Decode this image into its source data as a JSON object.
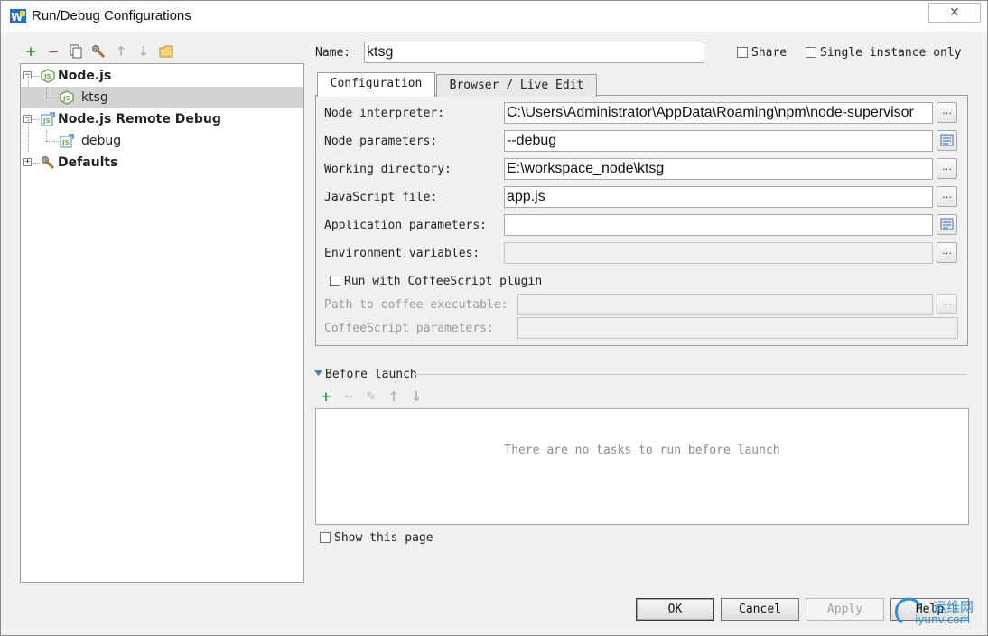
{
  "window": {
    "title": "Run/Debug Configurations"
  },
  "tree": {
    "items": [
      {
        "label": "Node.js"
      },
      {
        "label": "ktsg"
      },
      {
        "label": "Node.js Remote Debug"
      },
      {
        "label": "debug"
      },
      {
        "label": "Defaults"
      }
    ]
  },
  "name_row": {
    "label": "Name:",
    "value": "ktsg",
    "share_label": "Share",
    "single_instance_label": "Single instance only"
  },
  "tabs": [
    {
      "label": "Configuration"
    },
    {
      "label": "Browser / Live Edit"
    }
  ],
  "config": {
    "node_interpreter": {
      "label": "Node interpreter:",
      "value": "C:\\Users\\Administrator\\AppData\\Roaming\\npm\\node-supervisor"
    },
    "node_parameters": {
      "label": "Node parameters:",
      "value": "--debug"
    },
    "working_directory": {
      "label": "Working directory:",
      "value": "E:\\workspace_node\\ktsg"
    },
    "javascript_file": {
      "label": "JavaScript file:",
      "value": "app.js"
    },
    "application_parameters": {
      "label": "Application parameters:",
      "value": ""
    },
    "environment_variables": {
      "label": "Environment variables:",
      "value": ""
    },
    "coffee_plugin_label": "Run with CoffeeScript plugin",
    "coffee_path": {
      "label": "Path to coffee executable:",
      "value": ""
    },
    "coffee_params": {
      "label": "CoffeeScript parameters:",
      "value": ""
    }
  },
  "before_launch": {
    "title": "Before launch",
    "empty_text": "There are no tasks to run before launch"
  },
  "show_page_label": "Show this page",
  "buttons": {
    "ok": "OK",
    "cancel": "Cancel",
    "apply": "Apply",
    "help": "Help"
  },
  "watermark": {
    "line1": "运维网",
    "line2": "iyunv.com"
  },
  "colors": {
    "add_green": "#3a9c3a",
    "remove_red": "#c44040",
    "node_green": "#6aa84f",
    "selection": "#d4d4d4"
  }
}
